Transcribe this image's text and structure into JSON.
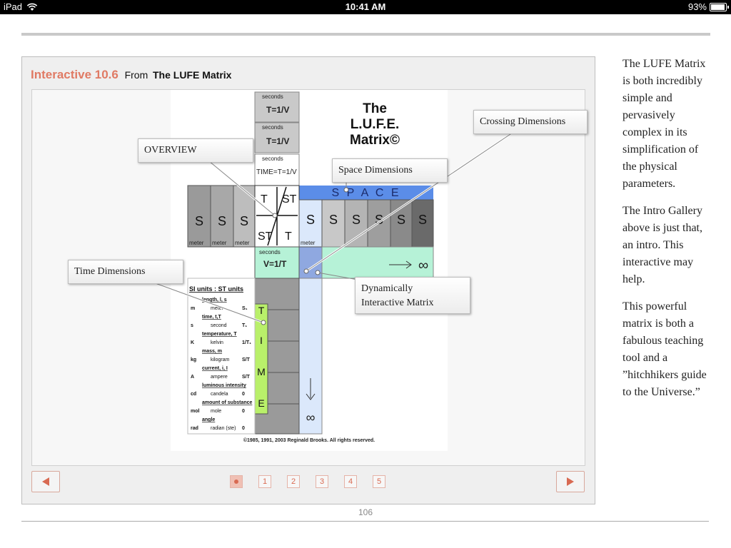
{
  "status_bar": {
    "device": "iPad",
    "time": "10:41 AM",
    "battery": "93%",
    "battery_level": 0.93
  },
  "widget": {
    "label": "Interactive 10.6",
    "from_text": "From",
    "book_title": "The LUFE Matrix",
    "copyright": "©1985, 1991, 2003 Reginald Brooks. All rights reserved.",
    "callouts": {
      "overview": "OVERVIEW",
      "crossing": "Crossing Dimensions",
      "space": "Space Dimensions",
      "time": "Time Dimensions",
      "dynamic_line1": "Dynamically",
      "dynamic_line2": "Interactive Matrix"
    },
    "matrix": {
      "title_line1": "The",
      "title_line2": "L.U.F.E.",
      "title_line3": "Matrix©",
      "space_word": "S P A C E",
      "time_letters": [
        "T",
        "I",
        "M",
        "E"
      ],
      "infinity": "∞",
      "seconds": "seconds",
      "meter": "meter",
      "si_header": "SI units : ST units",
      "si_rows": [
        {
          "head": "length, l, s",
          "sym": "m",
          "unit": "meter",
          "st": "S₁"
        },
        {
          "head": "time, t,T",
          "sym": "s",
          "unit": "second",
          "st": "T₁"
        },
        {
          "head": "temperature, T",
          "sym": "K",
          "unit": "kelvin",
          "st": "1/T₁"
        },
        {
          "head": "mass, m",
          "sym": "kg",
          "unit": "kilogram",
          "st": "S/T"
        },
        {
          "head": "current, i, I",
          "sym": "A",
          "unit": "ampere",
          "st": "S/T"
        },
        {
          "head": "luminous intensity",
          "sym": "cd",
          "unit": "candela",
          "st": "0"
        },
        {
          "head": "amount of substance",
          "sym": "mol",
          "unit": "mole",
          "st": "0"
        },
        {
          "head": "angle",
          "sym": "rad",
          "unit": "radian (ste)",
          "st": "0"
        }
      ]
    }
  },
  "navigation": {
    "prev_icon": "left-triangle-icon",
    "next_icon": "right-triangle-icon",
    "pages": [
      "1",
      "2",
      "3",
      "4",
      "5"
    ],
    "active": 0
  },
  "page_number": "106",
  "sidebar": {
    "paragraphs": [
      "The LUFE Matrix is both incredibly simple and pervasively complex in its simplification of the physical parameters.",
      "The Intro Gallery above is just that, an intro. This interactive may help.",
      "This powerful matrix is both a fabulous teaching tool and a ”hitchhikers guide to the Universe.”"
    ]
  },
  "colors": {
    "accent": "#e07a64",
    "space_blue": "#5b8de8",
    "time_green": "#b9f06a",
    "freq_mint": "#b6f2d7",
    "gray_dark": "#6a6a6a",
    "gray_mid": "#9a9a9a",
    "gray_light": "#c8c8c8"
  }
}
